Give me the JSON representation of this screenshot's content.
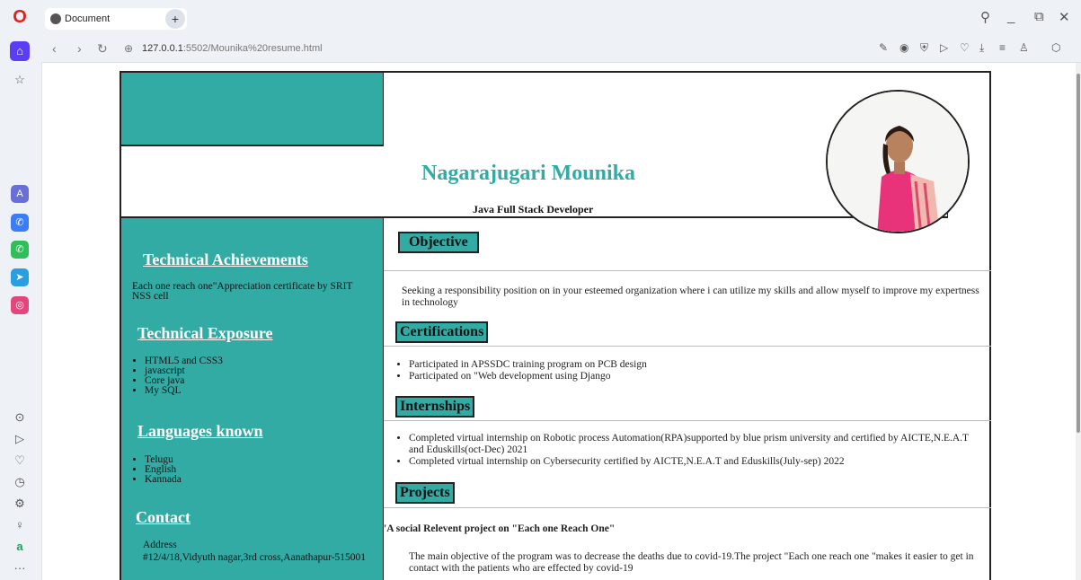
{
  "browser": {
    "tab_title": "Document",
    "new_tab": "+",
    "url_host": "127.0.0.1",
    "url_rest": ":5502/Mounika%20resume.html",
    "window_controls": [
      "search-icon",
      "minimize-icon",
      "snap-icon",
      "close-icon"
    ]
  },
  "sidebar_icons": [
    "opera-logo",
    "home-icon",
    "star-icon",
    "aria-icon",
    "messenger-icon",
    "whatsapp-icon",
    "telegram-icon",
    "instagram-icon",
    "player-icon",
    "send-icon",
    "heart-icon",
    "history-icon",
    "settings-icon",
    "lightbulb-icon",
    "extension-icon",
    "more-icon"
  ],
  "resume": {
    "name": "Nagarajugari Mounika",
    "role": "Java Full Stack Developer",
    "left": {
      "achievements_heading": "Technical Achievements",
      "achievements_text": "Each one reach one\"Appreciation certificate by SRIT NSS cell",
      "exposure_heading": "Technical Exposure",
      "exposure": [
        "HTML5 and CSS3",
        "javascript",
        "Core java",
        "My SQL"
      ],
      "languages_heading": "Languages known",
      "languages": [
        "Telugu",
        "English",
        "Kannada"
      ],
      "contact_heading": "Contact",
      "address_label": "Address",
      "address": "#12/4/18,Vidyuth nagar,3rd cross,Aanathapur-515001"
    },
    "right": {
      "objective_heading": "Objective",
      "objective_text": "Seeking a responsibility position on in your esteemed organization where i can utilize my skills and allow myself to improve my expertness in technology",
      "certifications_heading": "Certifications",
      "certifications": [
        "Participated in APSSDC training program on PCB design",
        "Participated on \"Web development using Django"
      ],
      "internships_heading": "Internships",
      "internships": [
        "Completed virtual internship on Robotic process Automation(RPA)supported by blue prism university and certified by AICTE,N.E.A.T and Eduskills(oct-Dec) 2021",
        "Completed virtual internship on Cybersecurity certified by AICTE,N.E.A.T and Eduskills(July-sep) 2022"
      ],
      "projects_heading": "Projects",
      "project_title": "'A social Relevent project on \"Each one Reach One\"",
      "project_text": "The main objective of the program was to decrease the deaths due to covid-19.The project \"Each one reach one \"makes it easier to get in contact with the patients who are effected by covid-19"
    }
  },
  "colors": {
    "teal": "#33aba5",
    "opera_red": "#e0201a",
    "opera_purple": "#5b3df5"
  }
}
